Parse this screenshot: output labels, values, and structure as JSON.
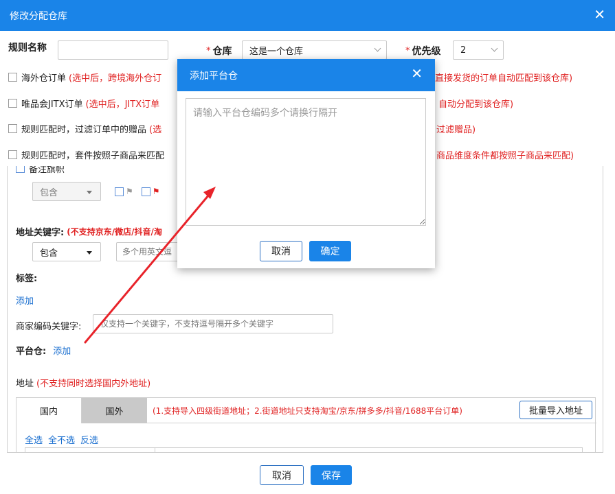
{
  "dialog": {
    "title": "修改分配仓库",
    "close_glyph": "✕"
  },
  "form": {
    "rule_name_label": "规则名称",
    "rule_name_value": "",
    "required_mark": "*",
    "warehouse_label": "仓库",
    "warehouse_value": "这是一个仓库",
    "priority_label": "优先级",
    "priority_value": "2"
  },
  "options": [
    {
      "label": "海外仓订单",
      "note": "(选中后，跨境海外仓订",
      "note_tail": "直接发货的订单自动匹配到该仓库)"
    },
    {
      "label": "唯品会JITX订单",
      "note": "(选中后，JITX订单",
      "note_tail": "自动分配到该仓库)"
    },
    {
      "label": "规则匹配时，过滤订单中的赠品",
      "note": "(选",
      "note_tail": "过滤赠品)"
    },
    {
      "label": "规则匹配时，套件按照子商品来匹配",
      "note": "",
      "note_tail": "商品维度条件都按照子商品来匹配)"
    }
  ],
  "panel": {
    "remark_flag_label": "备注旗帜",
    "flag_mode_value": "包含",
    "address_keyword_label": "地址关键字:",
    "address_keyword_note": "(不支持京东/微店/抖音/淘",
    "address_mode_value": "包含",
    "address_keyword_placeholder": "多个用英文逗",
    "tags_label": "标签:",
    "tags_add_link": "添加",
    "merchant_code_label": "商家编码关键字:",
    "merchant_code_placeholder": "仅支持一个关键字，不支持逗号隔开多个关键字",
    "platform_warehouse_label": "平台仓:",
    "platform_warehouse_add_link": "添加",
    "address_label": "地址",
    "address_note": "(不支持同时选择国内外地址)",
    "tabs": [
      {
        "label": "国内"
      },
      {
        "label": "国外"
      }
    ],
    "import_note": "(1.支持导入四级街道地址；2.街道地址只支持淘宝/京东/拼多多/抖音/1688平台订单)",
    "bulk_import_button": "批量导入地址",
    "select_all": "全选",
    "select_none": "全不选",
    "invert_select": "反选"
  },
  "footer": {
    "cancel_label": "取消",
    "save_label": "保存"
  },
  "modal": {
    "title": "添加平台仓",
    "close_glyph": "✕",
    "textarea_placeholder": "请输入平台仓编码多个请换行隔开",
    "cancel_label": "取消",
    "confirm_label": "确定"
  },
  "colors": {
    "accent": "#1a84e8",
    "note_red": "#e02020",
    "link_blue": "#1a6fd0",
    "arrow_red": "#e8232a"
  }
}
